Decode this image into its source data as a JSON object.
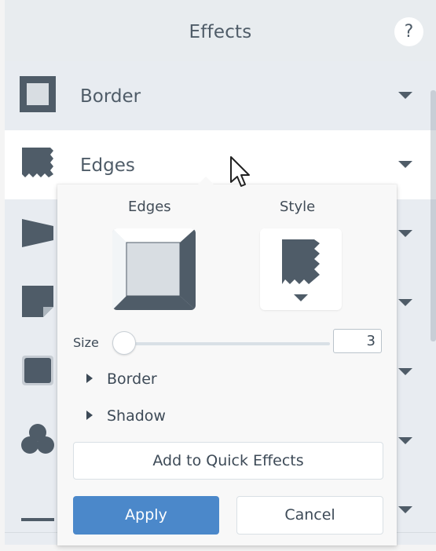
{
  "header": {
    "title": "Effects",
    "help_label": "?"
  },
  "effects": [
    {
      "label": "Border",
      "icon": "border-icon"
    },
    {
      "label": "Edges",
      "icon": "edges-icon"
    }
  ],
  "popup": {
    "edges_label": "Edges",
    "style_label": "Style",
    "size_label": "Size",
    "size_value": "3",
    "size_fraction": 0.04,
    "accordion": [
      {
        "label": "Border"
      },
      {
        "label": "Shadow"
      }
    ],
    "quick_effects_label": "Add to Quick Effects",
    "apply_label": "Apply",
    "cancel_label": "Cancel"
  },
  "colors": {
    "accent": "#4b88ca",
    "panel": "#f4f4f4",
    "row": "#e8ecf1",
    "selected_row": "#ffffff"
  },
  "icons": {
    "help": "help-icon",
    "dropdown": "chevron-down-icon",
    "cursor": "mouse-pointer-icon"
  }
}
